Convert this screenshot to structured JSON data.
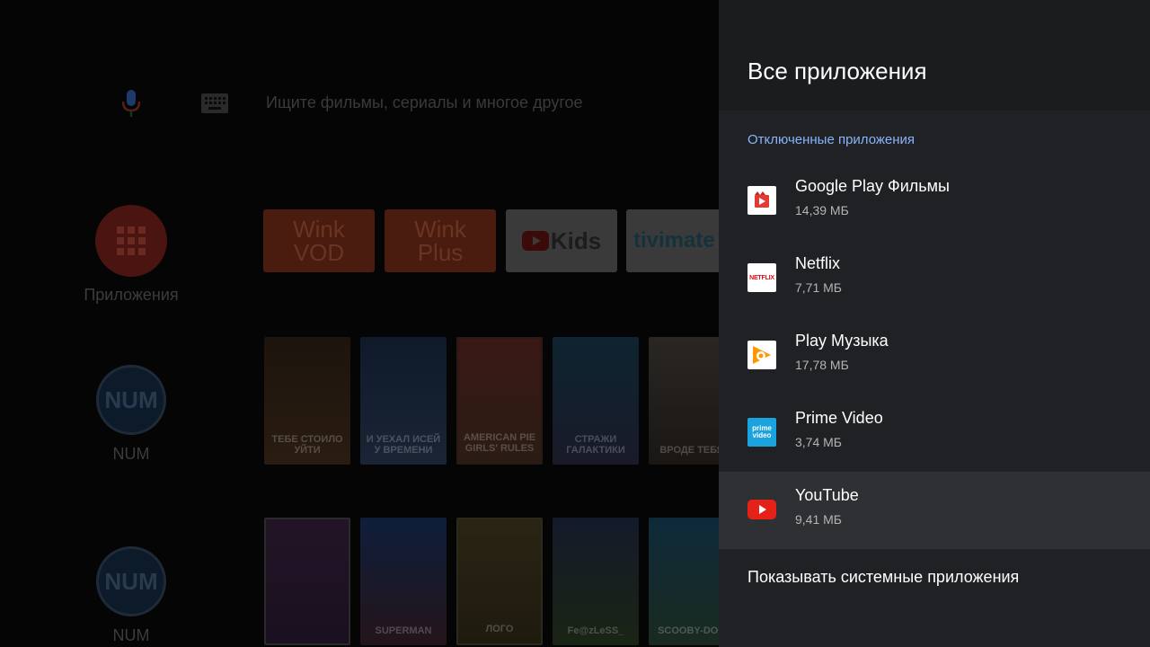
{
  "launcher": {
    "search_placeholder": "Ищите фильмы, сериалы и многое другое",
    "apps_label": "Приложения",
    "channels": [
      {
        "logo": "NUM",
        "label": "NUM"
      },
      {
        "logo": "NUM",
        "label": "NUM"
      }
    ],
    "tiles": [
      {
        "line1": "Wink",
        "line2": "VOD"
      },
      {
        "line1": "Wink",
        "line2": "Plus"
      },
      {
        "text": "Kids",
        "icon": "youtube-kids-icon"
      },
      {
        "text": "tivimate"
      }
    ],
    "row1_posters": [
      "ТЕБЕ СТОИЛО УЙТИ",
      "И УЕХАЛ ИСЕЙ У ВРЕМЕНИ",
      "AMERICAN PIE GIRLS' RULES",
      "СТРАЖИ ГАЛАКТИКИ",
      "ВРОДЕ ТЕБЯ"
    ],
    "row2_posters": [
      "",
      "SUPERMAN",
      "ЛОГО",
      "Fe@zLeSS_",
      "SCOOBY-DOO"
    ]
  },
  "panel": {
    "title": "Все приложения",
    "section_label": "Отключенные приложения",
    "apps": [
      {
        "name": "Google Play Фильмы",
        "size": "14,39 МБ",
        "icon": "google-play-movies-icon"
      },
      {
        "name": "Netflix",
        "size": "7,71 МБ",
        "icon": "netflix-icon",
        "logo_text": "NETFLIX"
      },
      {
        "name": "Play Музыка",
        "size": "17,78 МБ",
        "icon": "play-music-icon"
      },
      {
        "name": "Prime Video",
        "size": "3,74 МБ",
        "icon": "prime-video-icon",
        "logo_line1": "prime",
        "logo_line2": "video"
      },
      {
        "name": "YouTube",
        "size": "9,41 МБ",
        "icon": "youtube-icon",
        "focused": true
      }
    ],
    "system_toggle": "Показывать системные приложения"
  },
  "colors": {
    "panel_bg": "#202124",
    "header_bg": "#1b1c1e",
    "accent_blue": "#8ab4f8",
    "focused_row": "#2f3033"
  }
}
